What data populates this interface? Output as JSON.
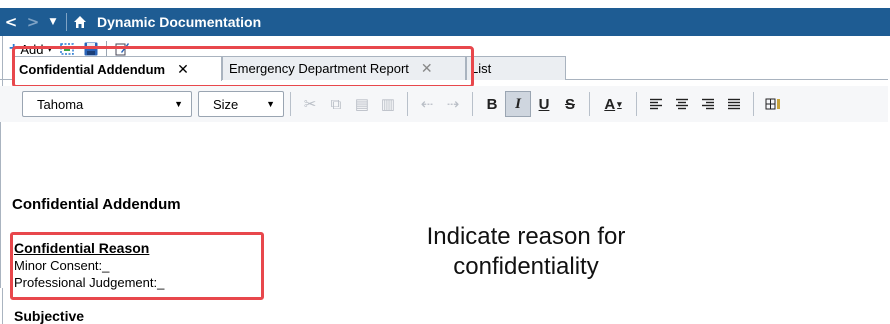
{
  "titlebar": {
    "title": "Dynamic Documentation",
    "back_glyph": "<",
    "forward_glyph": ">",
    "dropdown_glyph": "▼",
    "icons": [
      "back-icon",
      "forward-icon",
      "history-dropdown-icon",
      "home-icon"
    ]
  },
  "actionbar": {
    "add_label": "Add",
    "caret": "▾",
    "icons": [
      "add-plus-icon",
      "capture-icon",
      "save-icon",
      "edit-sign-icon"
    ]
  },
  "tabs": [
    {
      "label": "Confidential Addendum",
      "close": "✕",
      "active": true
    },
    {
      "label": "Emergency Department Report",
      "close": "✕",
      "active": false
    },
    {
      "label": "List",
      "active": false
    }
  ],
  "format_toolbar": {
    "font_value": "Tahoma",
    "size_value": "Size",
    "buttons": {
      "bold": "B",
      "italic": "I",
      "underline": "U",
      "strike": "S",
      "font_color": "A"
    }
  },
  "document": {
    "title": "Confidential Addendum",
    "reason_heading": "Confidential Reason",
    "lines": [
      "Minor Consent:_",
      "Professional Judgement:_"
    ],
    "next_heading": "Subjective"
  },
  "annotation": {
    "line1": "Indicate reason for",
    "line2": "confidentiality"
  },
  "colors": {
    "titlebar_bg": "#1e5c93",
    "highlight": "#e8474c"
  }
}
